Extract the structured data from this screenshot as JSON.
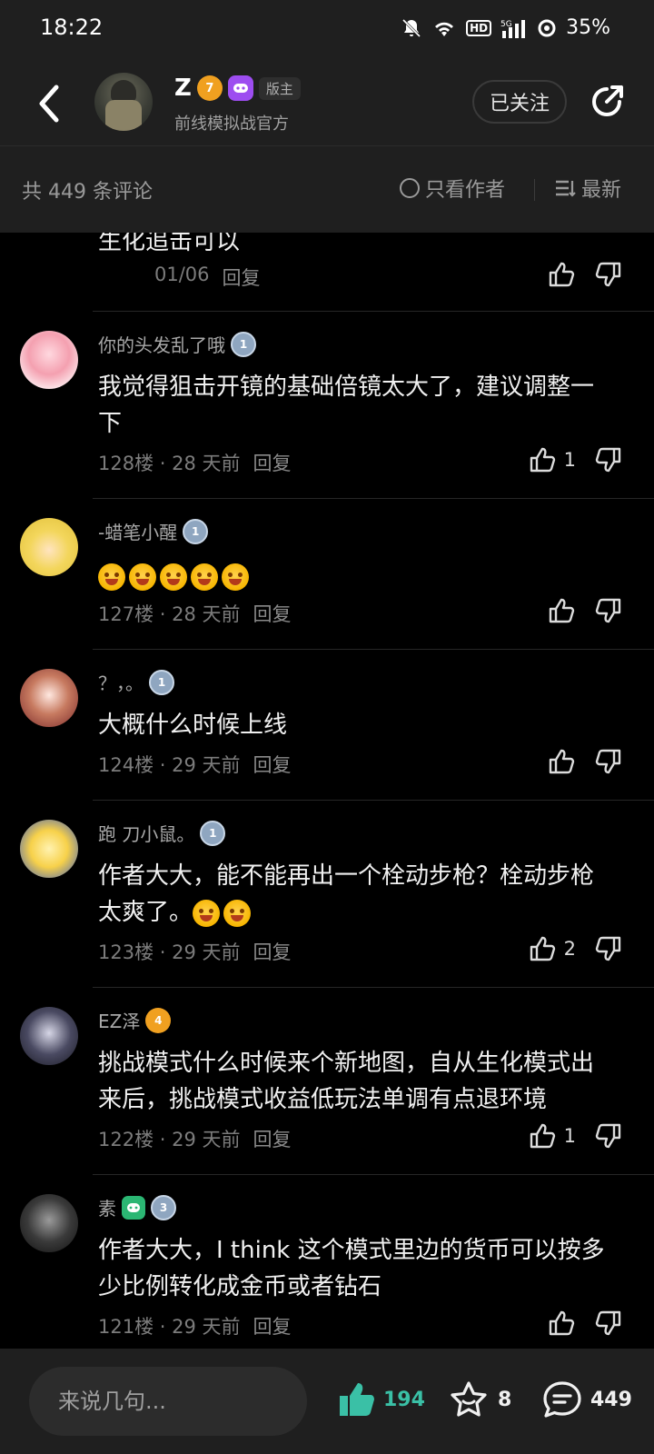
{
  "status": {
    "time": "18:22",
    "battery": "35%",
    "hd": "HD",
    "network": "5G"
  },
  "header": {
    "title": "Z",
    "level_badge": "7",
    "moderator_badge": "版主",
    "subtitle": "前线模拟战官方",
    "follow_label": "已关注"
  },
  "filter": {
    "count_label": "共 449 条评论",
    "only_author_label": "只看作者",
    "sort_label": "最新"
  },
  "comments": [
    {
      "text": "生化追击可以",
      "date": "01/06",
      "reply": "回复"
    },
    {
      "user": "你的头发乱了哦",
      "level": "1",
      "text": "我觉得狙击开镜的基础倍镜太大了，建议调整一下",
      "meta": "128楼 · 28 天前",
      "reply": "回复",
      "likes": "1"
    },
    {
      "user": "-蜡笔小醒",
      "level": "1",
      "text": "",
      "meta": "127楼 · 28 天前",
      "reply": "回复",
      "likes": ""
    },
    {
      "user": "？，。",
      "level": "1",
      "text": "大概什么时候上线",
      "meta": "124楼 · 29 天前",
      "reply": "回复",
      "likes": ""
    },
    {
      "user": "跑 刀小鼠。",
      "level": "1",
      "text": "作者大大，能不能再出一个栓动步枪？栓动步枪太爽了。",
      "meta": "123楼 · 29 天前",
      "reply": "回复",
      "likes": "2"
    },
    {
      "user": "EZ泽",
      "level": "4",
      "text": "挑战模式什么时候来个新地图，自从生化模式出来后，挑战模式收益低玩法单调有点退环境",
      "meta": "122楼 · 29 天前",
      "reply": "回复",
      "likes": "1"
    },
    {
      "user": "素",
      "level": "3",
      "text": "作者大大，I think 这个模式里边的货币可以按多少比例转化成金币或者钻石",
      "meta": "121楼 · 29 天前",
      "reply": "回复",
      "likes": ""
    }
  ],
  "bottom": {
    "input_placeholder": "来说几句...",
    "likes": "194",
    "stars": "8",
    "comments": "449"
  },
  "colors": {
    "accent": "#3ac0a6",
    "level_gold": "#f0a020",
    "level_silver": "#8fa6c0",
    "game_purple": "#9d4df0"
  }
}
